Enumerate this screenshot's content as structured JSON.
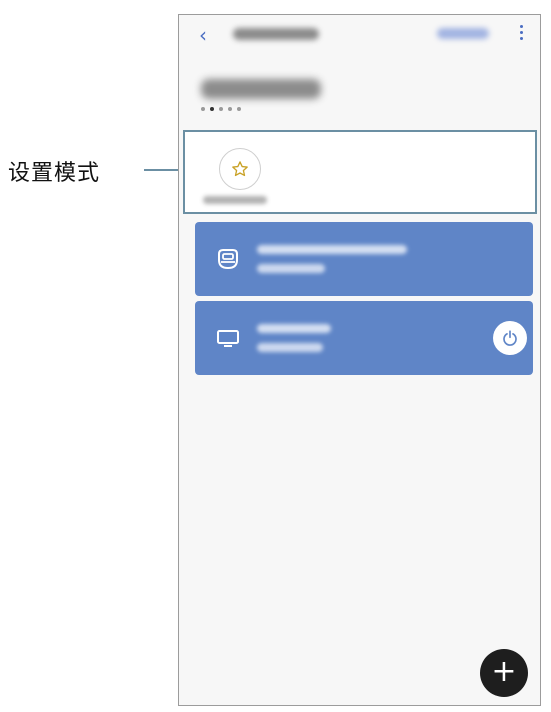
{
  "callout": {
    "text": "设置模式"
  },
  "topbar": {
    "back_icon": "‹"
  },
  "location": {
    "page_count": 5,
    "active_index": 1
  },
  "mode_card": {
    "icon": "star-icon"
  },
  "devices": [
    {
      "icon": "robot-vacuum-icon"
    },
    {
      "icon": "tv-icon",
      "power_icon": "power-icon"
    }
  ],
  "fab": {
    "label": "+"
  },
  "colors": {
    "accent": "#4a6dc2",
    "card_blue": "#5f85c7",
    "callout_line": "#6b8fa3"
  }
}
